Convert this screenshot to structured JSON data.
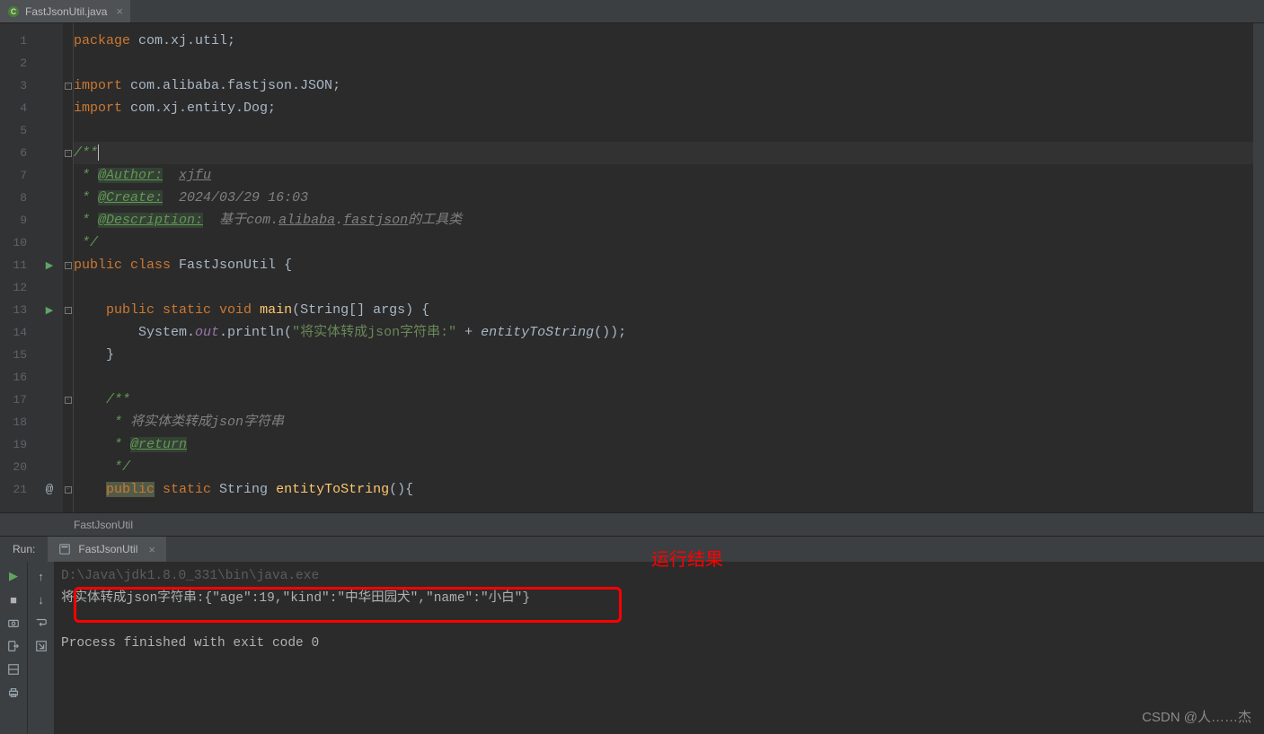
{
  "tab": {
    "filename": "FastJsonUtil.java"
  },
  "breadcrumb": "FastJsonUtil",
  "gutter": {
    "line_numbers": [
      "1",
      "2",
      "3",
      "4",
      "5",
      "6",
      "7",
      "8",
      "9",
      "10",
      "11",
      "12",
      "13",
      "14",
      "15",
      "16",
      "17",
      "18",
      "19",
      "20",
      "21"
    ]
  },
  "code": {
    "l1": {
      "kw": "package ",
      "pkg": "com.xj.util",
      "semi": ";"
    },
    "l3": {
      "kw": "import ",
      "pkg": "com.alibaba.fastjson.JSON",
      "semi": ";"
    },
    "l4": {
      "kw": "import ",
      "pkg": "com.xj.entity.Dog",
      "semi": ";"
    },
    "l6": "/**",
    "l7": {
      "star": " * ",
      "tag": "@Author:",
      "sp": "  ",
      "val": "xjfu"
    },
    "l8": {
      "star": " * ",
      "tag": "@Create:",
      "sp": "  ",
      "val": "2024/03/29 16:03"
    },
    "l9": {
      "star": " * ",
      "tag": "@Description:",
      "sp": "  ",
      "pre": "基于",
      "linkA": "com.",
      "linkB": "alibaba",
      "linkC": ".",
      "linkD": "fastjson",
      "post": "的工具类"
    },
    "l10": " */",
    "l11": {
      "kw1": "public ",
      "kw2": "class ",
      "cls": "FastJsonUtil ",
      "brace": "{"
    },
    "l13": {
      "indent": "    ",
      "kw1": "public ",
      "kw2": "static ",
      "kw3": "void ",
      "m": "main",
      "p": "(String[] args) {"
    },
    "l14": {
      "indent": "        ",
      "a": "System.",
      "out": "out",
      "b": ".println(",
      "str": "\"将实体转成json字符串:\"",
      "c": " + ",
      "call": "entityToString",
      "d": "());"
    },
    "l15": "    }",
    "l17": {
      "indent": "    ",
      "txt": "/**"
    },
    "l18": {
      "indent": "     * ",
      "txt": "将实体类转成json字符串"
    },
    "l19": {
      "indent": "     * ",
      "tag": "@return"
    },
    "l20": {
      "indent": "     ",
      "txt": "*/"
    },
    "l21": {
      "indent": "    ",
      "kw1": "public",
      "kw2": " static ",
      "ret": "String ",
      "m": "entityToString",
      "p": "(){"
    },
    "l21_anno": "@"
  },
  "run": {
    "label": "Run:",
    "tab": "FastJsonUtil"
  },
  "console": {
    "path": "D:\\Java\\jdk1.8.0_331\\bin\\java.exe",
    "output": "将实体转成json字符串:{\"age\":19,\"kind\":\"中华田园犬\",\"name\":\"小白\"}",
    "exit": "Process finished with exit code 0"
  },
  "annotation": {
    "label": "运行结果"
  },
  "watermark": "CSDN @人……杰"
}
